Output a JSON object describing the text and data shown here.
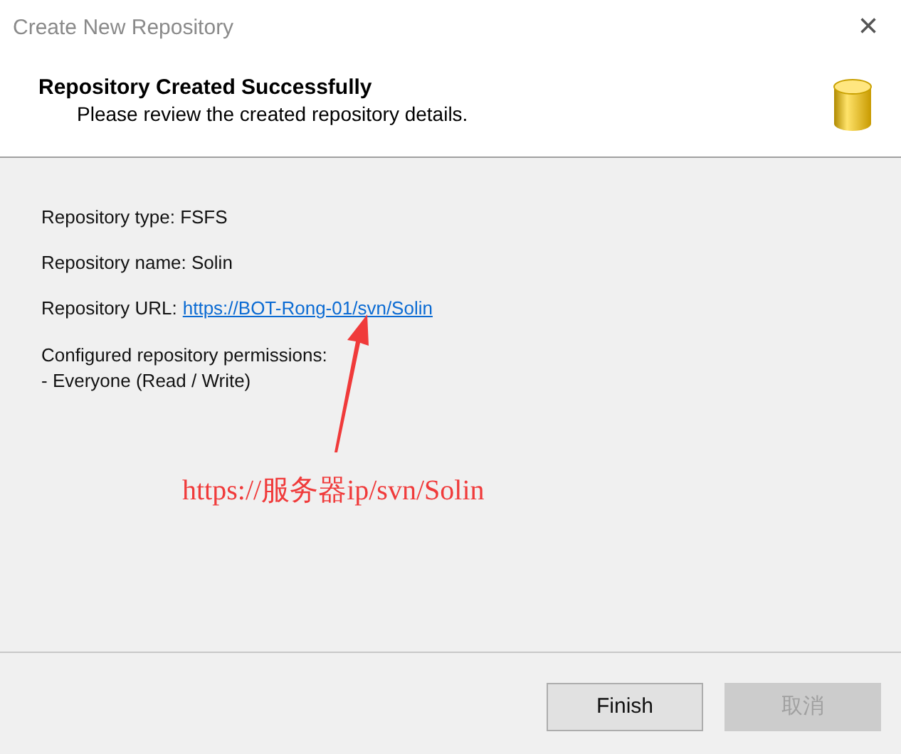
{
  "window": {
    "title": "Create New Repository",
    "close": "×"
  },
  "header": {
    "title": "Repository Created Successfully",
    "subtitle": "Please review the created repository details."
  },
  "details": [
    {
      "kind": "text",
      "label": "Repository type:",
      "value": "FSFS"
    },
    {
      "kind": "text",
      "label": "Repository name:",
      "value": "Solin"
    },
    {
      "kind": "link",
      "label": "Repository URL:",
      "value": "https://BOT-Rong-01/svn/Solin"
    }
  ],
  "permissions": {
    "heading": "Configured repository permissions:",
    "items": [
      "- Everyone (Read / Write)"
    ]
  },
  "annotation": {
    "text": "https://服务器ip/svn/Solin"
  },
  "buttons": [
    {
      "label": "Finish",
      "disabled": false
    },
    {
      "label": "取消",
      "disabled": true
    }
  ]
}
